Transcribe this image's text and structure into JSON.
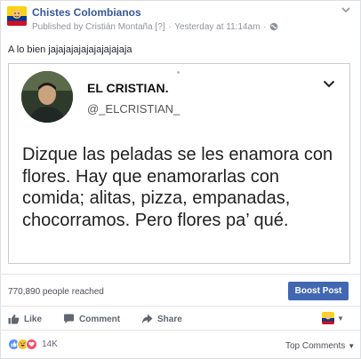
{
  "post": {
    "page_name": "Chistes Colombianos",
    "published_by": "Published by Cristián Montaña",
    "help_mark": "[?]",
    "timestamp": "Yesterday at 11:14am",
    "dot": "·",
    "text": "A lo bien jajajajajajajajajajaja"
  },
  "tweet": {
    "name": "EL CRISTIAN.",
    "handle": "@_ELCRISTIAN_",
    "body": "Dizque las peladas se les enamora con flores. Hay que enamorarlas con comida; alitas, pizza, empanadas, chocorramos. Pero flores pa’ qué."
  },
  "insights": {
    "reach": "770,890 people reached",
    "boost_label": "Boost Post"
  },
  "actions": {
    "like": "Like",
    "comment": "Comment",
    "share": "Share"
  },
  "reactions": {
    "icons": [
      "like-reaction",
      "haha-reaction",
      "love-reaction"
    ],
    "count": "14K"
  },
  "comments_sort": "Top Comments",
  "colors": {
    "link_blue": "#365899",
    "boost_blue": "#4267b2",
    "like_blue": "#5890ff",
    "haha_yellow": "#f5c33b",
    "love_red": "#f25268"
  }
}
